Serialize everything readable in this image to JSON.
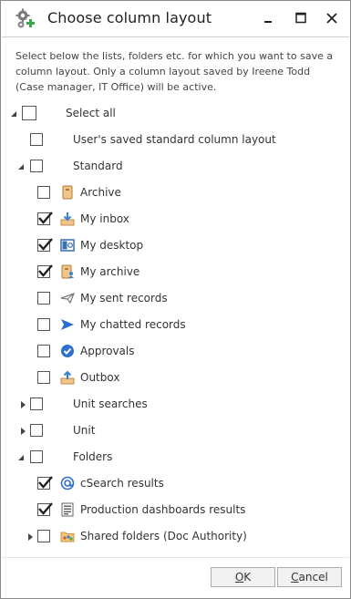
{
  "window": {
    "title": "Choose column layout"
  },
  "description": "Select below the lists, folders etc. for which you want to save a column layout. Only a column layout saved by Ireene Todd (Case manager, IT Office) will be active.",
  "tree": {
    "select_all": {
      "label": "Select all",
      "checked": false,
      "expanded": true
    },
    "users_saved": {
      "label": "User's saved standard column layout",
      "checked": false
    },
    "standard": {
      "label": "Standard",
      "checked": false,
      "expanded": true,
      "items": [
        {
          "label": "Archive",
          "checked": false,
          "icon": "archive-icon"
        },
        {
          "label": "My inbox",
          "checked": true,
          "icon": "inbox-icon"
        },
        {
          "label": "My desktop",
          "checked": true,
          "icon": "desktop-icon"
        },
        {
          "label": "My archive",
          "checked": true,
          "icon": "my-archive-icon"
        },
        {
          "label": "My sent records",
          "checked": false,
          "icon": "sent-records-icon"
        },
        {
          "label": "My chatted records",
          "checked": false,
          "icon": "chatted-records-icon"
        },
        {
          "label": "Approvals",
          "checked": false,
          "icon": "approvals-icon"
        },
        {
          "label": "Outbox",
          "checked": false,
          "icon": "outbox-icon"
        }
      ]
    },
    "unit_searches": {
      "label": "Unit searches",
      "checked": false,
      "expanded": false
    },
    "unit": {
      "label": "Unit",
      "checked": false,
      "expanded": false
    },
    "folders": {
      "label": "Folders",
      "checked": false,
      "expanded": true,
      "items": [
        {
          "label": "cSearch results",
          "checked": true,
          "icon": "csearch-icon"
        },
        {
          "label": "Production dashboards results",
          "checked": true,
          "icon": "dashboard-icon"
        }
      ],
      "shared": {
        "label": "Shared folders (Doc Authority)",
        "checked": false,
        "expanded": false,
        "icon": "shared-folder-icon"
      }
    }
  },
  "buttons": {
    "ok": "OK",
    "cancel": "Cancel"
  }
}
